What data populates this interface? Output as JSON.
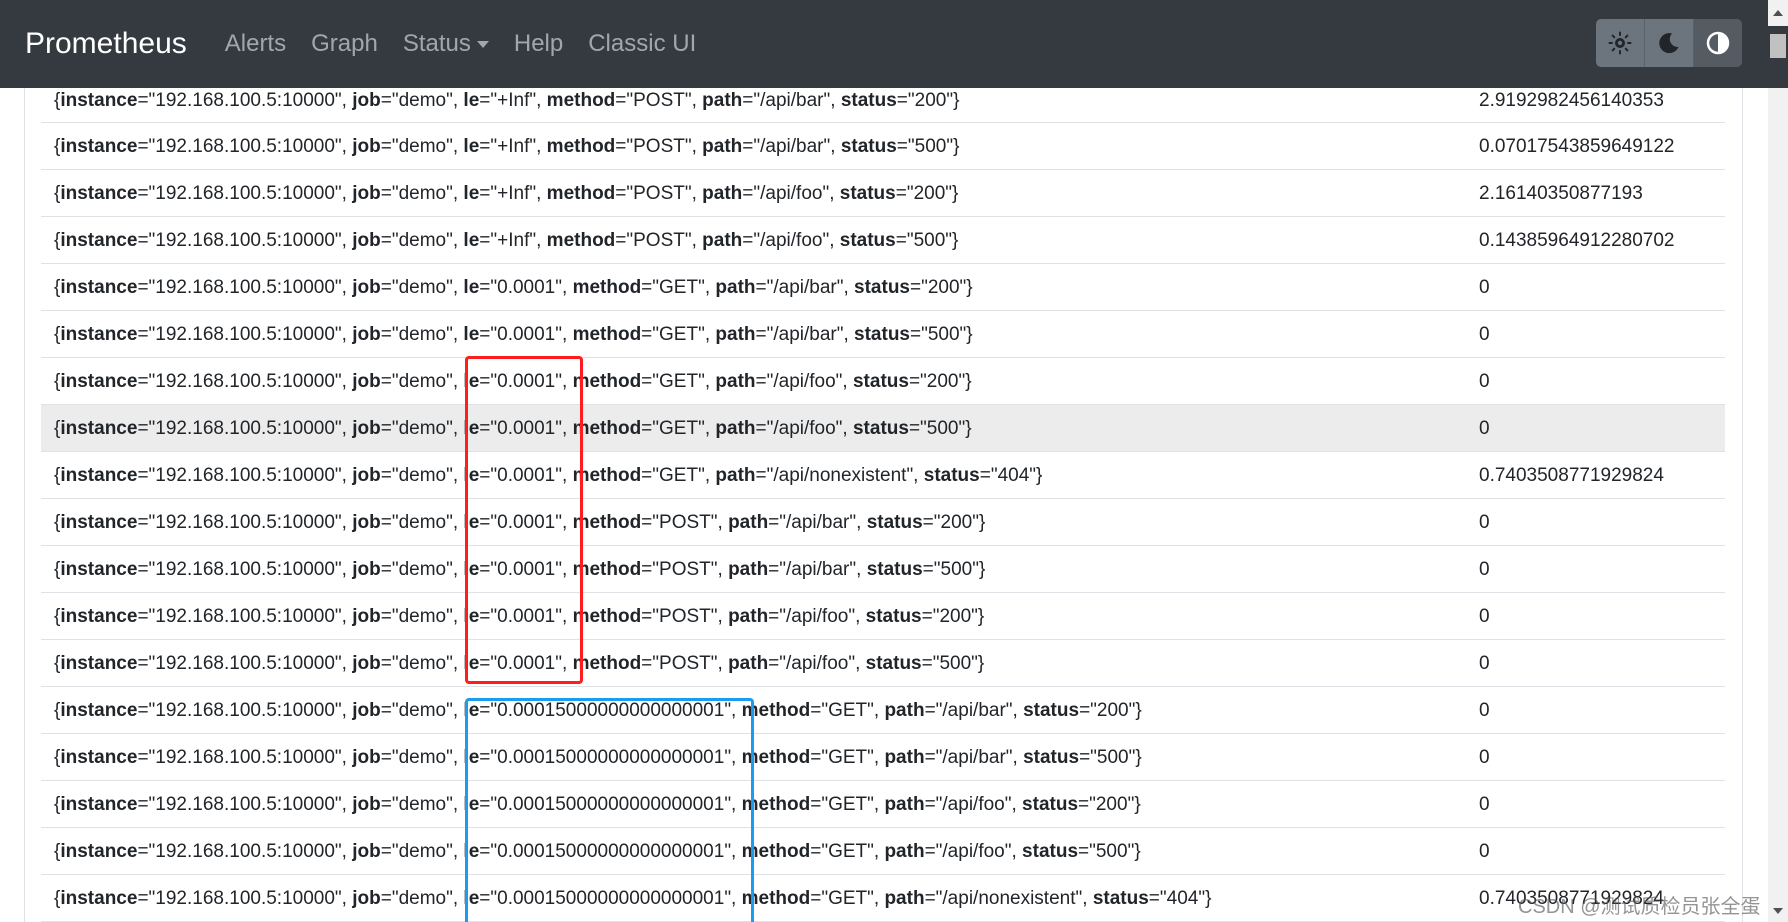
{
  "navbar": {
    "brand": "Prometheus",
    "links": [
      {
        "label": "Alerts"
      },
      {
        "label": "Graph"
      },
      {
        "label": "Status"
      },
      {
        "label": "Help"
      },
      {
        "label": "Classic UI"
      }
    ]
  },
  "theme_buttons": [
    {
      "name": "light-theme-button",
      "icon": "sun-icon"
    },
    {
      "name": "dark-theme-button",
      "icon": "moon-icon"
    },
    {
      "name": "browser-theme-button",
      "icon": "half-circle-icon"
    }
  ],
  "rows": [
    {
      "instance": "192.168.100.5:10000",
      "job": "demo",
      "le": "+Inf",
      "method": "POST",
      "path": "/api/bar",
      "status": "200",
      "value": "2.9192982456140353"
    },
    {
      "instance": "192.168.100.5:10000",
      "job": "demo",
      "le": "+Inf",
      "method": "POST",
      "path": "/api/bar",
      "status": "500",
      "value": "0.07017543859649122"
    },
    {
      "instance": "192.168.100.5:10000",
      "job": "demo",
      "le": "+Inf",
      "method": "POST",
      "path": "/api/foo",
      "status": "200",
      "value": "2.16140350877193"
    },
    {
      "instance": "192.168.100.5:10000",
      "job": "demo",
      "le": "+Inf",
      "method": "POST",
      "path": "/api/foo",
      "status": "500",
      "value": "0.14385964912280702"
    },
    {
      "instance": "192.168.100.5:10000",
      "job": "demo",
      "le": "0.0001",
      "method": "GET",
      "path": "/api/bar",
      "status": "200",
      "value": "0"
    },
    {
      "instance": "192.168.100.5:10000",
      "job": "demo",
      "le": "0.0001",
      "method": "GET",
      "path": "/api/bar",
      "status": "500",
      "value": "0"
    },
    {
      "instance": "192.168.100.5:10000",
      "job": "demo",
      "le": "0.0001",
      "method": "GET",
      "path": "/api/foo",
      "status": "200",
      "value": "0"
    },
    {
      "instance": "192.168.100.5:10000",
      "job": "demo",
      "le": "0.0001",
      "method": "GET",
      "path": "/api/foo",
      "status": "500",
      "value": "0",
      "highlighted": true
    },
    {
      "instance": "192.168.100.5:10000",
      "job": "demo",
      "le": "0.0001",
      "method": "GET",
      "path": "/api/nonexistent",
      "status": "404",
      "value": "0.7403508771929824"
    },
    {
      "instance": "192.168.100.5:10000",
      "job": "demo",
      "le": "0.0001",
      "method": "POST",
      "path": "/api/bar",
      "status": "200",
      "value": "0"
    },
    {
      "instance": "192.168.100.5:10000",
      "job": "demo",
      "le": "0.0001",
      "method": "POST",
      "path": "/api/bar",
      "status": "500",
      "value": "0"
    },
    {
      "instance": "192.168.100.5:10000",
      "job": "demo",
      "le": "0.0001",
      "method": "POST",
      "path": "/api/foo",
      "status": "200",
      "value": "0"
    },
    {
      "instance": "192.168.100.5:10000",
      "job": "demo",
      "le": "0.0001",
      "method": "POST",
      "path": "/api/foo",
      "status": "500",
      "value": "0"
    },
    {
      "instance": "192.168.100.5:10000",
      "job": "demo",
      "le": "0.00015000000000000001",
      "method": "GET",
      "path": "/api/bar",
      "status": "200",
      "value": "0"
    },
    {
      "instance": "192.168.100.5:10000",
      "job": "demo",
      "le": "0.00015000000000000001",
      "method": "GET",
      "path": "/api/bar",
      "status": "500",
      "value": "0"
    },
    {
      "instance": "192.168.100.5:10000",
      "job": "demo",
      "le": "0.00015000000000000001",
      "method": "GET",
      "path": "/api/foo",
      "status": "200",
      "value": "0"
    },
    {
      "instance": "192.168.100.5:10000",
      "job": "demo",
      "le": "0.00015000000000000001",
      "method": "GET",
      "path": "/api/foo",
      "status": "500",
      "value": "0"
    },
    {
      "instance": "192.168.100.5:10000",
      "job": "demo",
      "le": "0.00015000000000000001",
      "method": "GET",
      "path": "/api/nonexistent",
      "status": "404",
      "value": "0.7403508771929824"
    }
  ],
  "watermark": "CSDN @测试质检员张全蛋",
  "colors": {
    "navbar_bg": "#343a40",
    "highlight_red": "#ff1e1e",
    "highlight_blue": "#1a9cf0",
    "row_hover": "#ececec"
  }
}
